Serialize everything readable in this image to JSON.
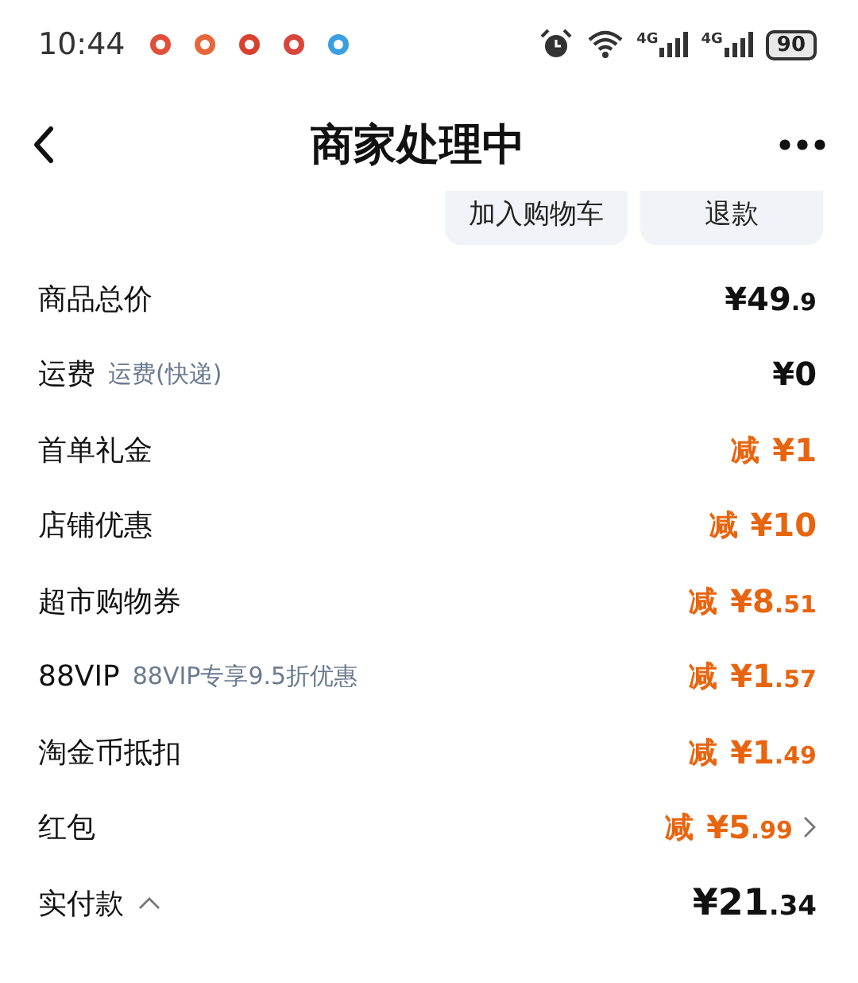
{
  "status_bar": {
    "time": "10:44",
    "notification_icons": [
      {
        "color": "#e0503a"
      },
      {
        "color": "#e8673a"
      },
      {
        "color": "#d9412f"
      },
      {
        "color": "#d9453a"
      },
      {
        "color": "#3a9ee0"
      }
    ],
    "network_labels": [
      "4G",
      "4G"
    ],
    "battery": "90"
  },
  "nav": {
    "title": "商家处理中"
  },
  "actions": [
    "加入购物车",
    "退款"
  ],
  "price_rows": [
    {
      "label": "商品总价",
      "discount": false,
      "amount": {
        "main": "¥49",
        "fraction": ".9"
      }
    },
    {
      "label": "运费",
      "note": "运费(快递)",
      "discount": false,
      "amount": {
        "main": "¥0"
      }
    },
    {
      "label": "首单礼金",
      "discount": true,
      "prefix": "减",
      "amount": {
        "main": "¥1"
      }
    },
    {
      "label": "店铺优惠",
      "discount": true,
      "prefix": "减",
      "amount": {
        "main": "¥10"
      }
    },
    {
      "label": "超市购物券",
      "discount": true,
      "prefix": "减",
      "amount": {
        "main": "¥8",
        "fraction": ".51"
      }
    },
    {
      "label": "88VIP",
      "note": "88VIP专享9.5折优惠",
      "discount": true,
      "prefix": "减",
      "amount": {
        "main": "¥1",
        "fraction": ".57"
      }
    },
    {
      "label": "淘金币抵扣",
      "discount": true,
      "prefix": "减",
      "amount": {
        "main": "¥1",
        "fraction": ".49"
      }
    },
    {
      "label": "红包",
      "discount": true,
      "prefix": "减",
      "amount": {
        "main": "¥5",
        "fraction": ".99"
      },
      "has_link": true
    }
  ],
  "total": {
    "label": "实付款",
    "expanded": true,
    "amount": {
      "main": "¥21",
      "fraction": ".34"
    }
  }
}
